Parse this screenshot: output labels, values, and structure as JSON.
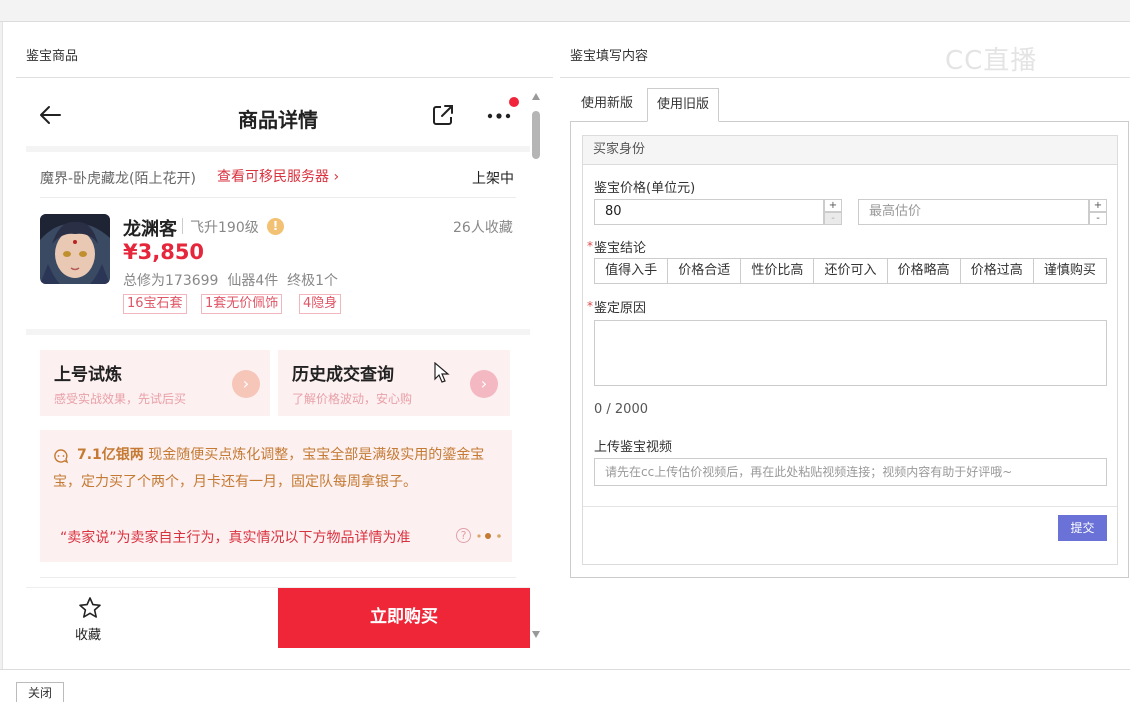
{
  "left_section": {
    "title": "鉴宝商品"
  },
  "right_section": {
    "title": "鉴宝填写内容"
  },
  "watermark": "CC直播",
  "product": {
    "nav": {
      "title": "商品详情",
      "back_icon": "arrow-left-icon",
      "share_icon": "share-icon",
      "more_icon": "more-dots-icon"
    },
    "server": {
      "name": "魔界-卧虎藏龙(陌上花开)",
      "link": "查看可移民服务器",
      "status": "上架中"
    },
    "character": {
      "name": "龙渊客",
      "level": "飞升190级",
      "favorites": "26人收藏",
      "price": "¥3,850",
      "stats": "总修为173699  仙器4件  终极1个",
      "tags": [
        "16宝石套",
        "1套无价佩饰",
        "4隐身"
      ]
    },
    "cards": [
      {
        "title": "上号试炼",
        "subtitle": "感受实战效果，先试后买",
        "color": "#f4b8a9"
      },
      {
        "title": "历史成交查询",
        "subtitle": "了解价格波动，安心购",
        "color": "#f1a7b3"
      }
    ],
    "description": {
      "highlight": "7.1亿银两",
      "text": "现金随便买点炼化调整，宝宝全部是满级实用的鎏金宝宝，定力买了个两个，月卡还有一月，固定队每周拿银子。",
      "disclaimer": "“卖家说”为卖家自主行为，真实情况以下方物品详情为准"
    },
    "bottom": {
      "favorite_label": "收藏",
      "buy_label": "立即购买"
    }
  },
  "form": {
    "tabs": [
      "使用新版",
      "使用旧版"
    ],
    "active_tab": "使用旧版",
    "header": "买家身份",
    "price_label": "鉴宝价格(单位元)",
    "price_value": "80",
    "max_placeholder": "最高估价",
    "spin_up": "+",
    "spin_down": "-",
    "required_mark": "*",
    "conclusion_label": "鉴宝结论",
    "conclusion_options": [
      "值得入手",
      "价格合适",
      "性价比高",
      "还价可入",
      "价格略高",
      "价格过高",
      "谨慎购买"
    ],
    "reason_label": "鉴定原因",
    "char_count": "0 / 2000",
    "video_label": "上传鉴宝视频",
    "video_placeholder": "请先在cc上传估价视频后，再在此处粘贴视频连接；视频内容有助于好评哦~",
    "submit_label": "提交"
  },
  "footer": {
    "close_label": "关闭"
  },
  "colors": {
    "accent_red": "#ee2638",
    "submit_blue": "#6a72d8",
    "desc_orange": "#c47a33"
  }
}
